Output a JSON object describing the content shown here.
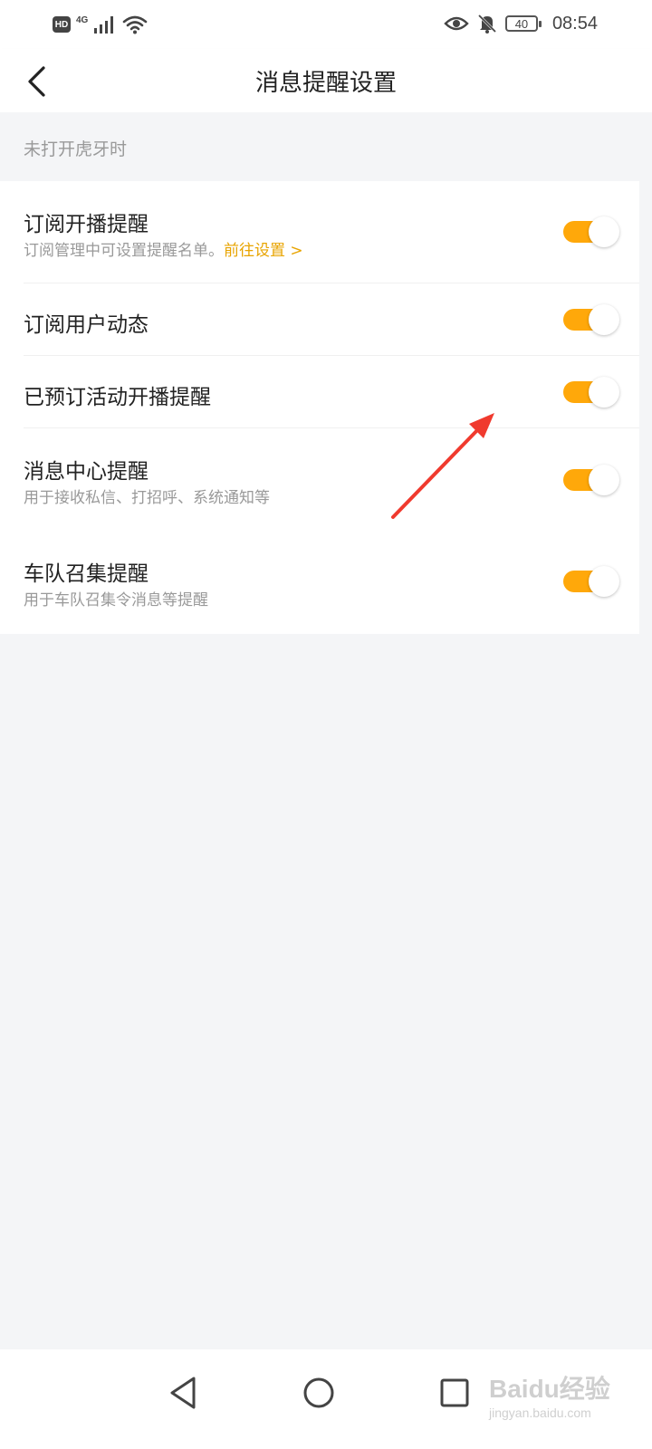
{
  "status_bar": {
    "hd_label": "HD",
    "network_label": "4G",
    "battery_level": "40",
    "time": "08:54",
    "icons": [
      "signal-icon",
      "wifi-icon",
      "eye-icon",
      "bell-off-icon",
      "battery-icon"
    ]
  },
  "header": {
    "title": "消息提醒设置"
  },
  "section": {
    "title": "未打开虎牙时"
  },
  "settings": [
    {
      "title": "订阅开播提醒",
      "subtitle": "订阅管理中可设置提醒名单。",
      "link": "前往设置 >",
      "enabled": true
    },
    {
      "title": "订阅用户动态",
      "enabled": true
    },
    {
      "title": "已预订活动开播提醒",
      "enabled": true
    },
    {
      "title": "消息中心提醒",
      "subtitle": "用于接收私信、打招呼、系统通知等",
      "enabled": true
    },
    {
      "title": "车队召集提醒",
      "subtitle": "用于车队召集令消息等提醒",
      "enabled": true
    }
  ],
  "system_nav": {
    "icons": [
      "back-triangle-icon",
      "home-circle-icon",
      "recents-square-icon"
    ]
  },
  "watermark": {
    "main": "Baidu经验",
    "sub": "jingyan.baidu.com"
  },
  "colors": {
    "accent": "#ffa80a",
    "link": "#e8a400",
    "arrow": "#f03a2e"
  }
}
